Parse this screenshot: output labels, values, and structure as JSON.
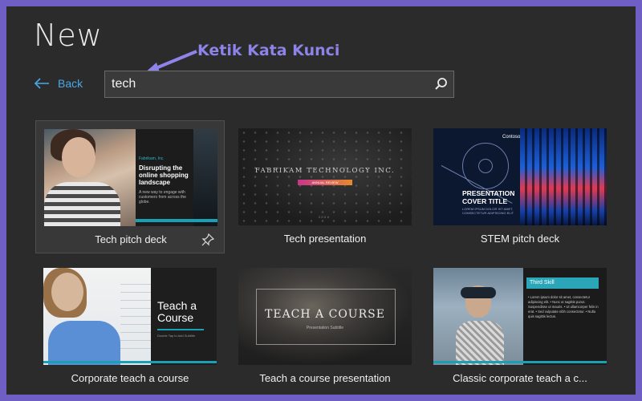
{
  "header": {
    "title": "New"
  },
  "annotation": {
    "text": "Ketik Kata Kunci"
  },
  "back": {
    "label": "Back"
  },
  "search": {
    "value": "tech"
  },
  "colors": {
    "frame": "#6f5fc4",
    "background": "#2b2b2b",
    "accent": "#4aa8e8",
    "annotation": "#8e83e8",
    "teal": "#1aa0b4"
  },
  "templates": [
    {
      "label": "Tech pitch deck",
      "thumb": {
        "brand": "Fabrikam, Inc.",
        "headline": "Disrupting the online shopping landscape",
        "body": "A new way to engage with customers from across the globe."
      }
    },
    {
      "label": "Tech presentation",
      "thumb": {
        "headline": "FABRIKAM TECHNOLOGY INC.",
        "tag": "ANNUAL REVIEW",
        "foot": "2 0 X X"
      }
    },
    {
      "label": "STEM pitch deck",
      "thumb": {
        "brand": "Contoso",
        "headline_line1": "PRESENTATION",
        "headline_line2": "COVER TITLE",
        "sub": "LOREM IPSUM DOLOR SIT AMET, CONSECTETUR ADIPISCING ELIT"
      }
    },
    {
      "label": "Corporate teach a course",
      "thumb": {
        "headline_line1": "Teach a",
        "headline_line2": "Course",
        "sub": "Double Tap to Add Subtitle"
      }
    },
    {
      "label": "Teach a course presentation",
      "thumb": {
        "headline": "TEACH A COURSE",
        "sub": "Presentation Subtitle"
      }
    },
    {
      "label": "Classic corporate teach a c...",
      "thumb": {
        "headline": "Third Skill",
        "bullets": "• Lorem ipsum dolor sit amet, consectetur adipiscing elit. • Nunc ut sagittis purus. Suspendisse ut mauris. • Ut ullamcorper felis in erat. • Sed vulputate nibh consectetur. • Nulla quis sagittis lectus."
      }
    }
  ]
}
